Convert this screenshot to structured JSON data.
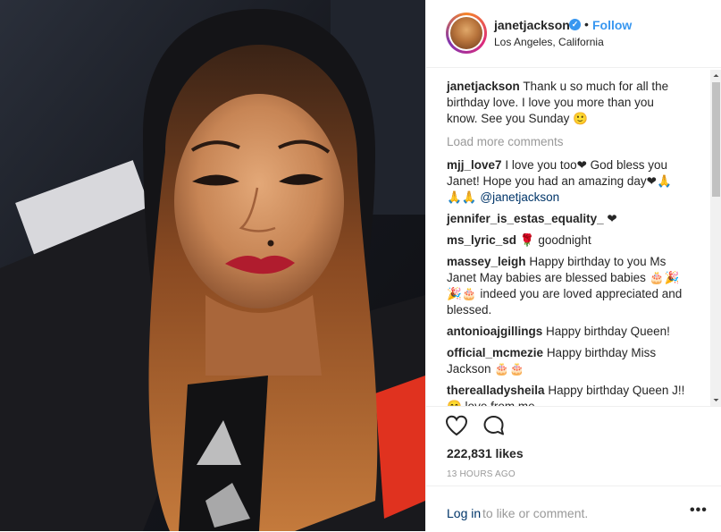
{
  "header": {
    "username": "janetjackson",
    "follow_label": "Follow",
    "dot": "•",
    "location": "Los Angeles, California"
  },
  "caption": {
    "username": "janetjackson",
    "text": "Thank u so much for all the birthday love. I love you more than you know. See you Sunday 🙂"
  },
  "load_more_label": "Load more comments",
  "comments": [
    {
      "username": "mjj_love7",
      "text": "I love you too❤ God bless you Janet! Hope you had an amazing day❤🙏 🙏🙏",
      "mention": "@janetjackson"
    },
    {
      "username": "jennifer_is_estas_equality_",
      "text": "❤"
    },
    {
      "username": "ms_lyric_sd",
      "text": "🌹 goodnight"
    },
    {
      "username": "massey_leigh",
      "text": "Happy birthday to you Ms Janet May babies are blessed babies 🎂🎉🎉🎂 indeed you are loved appreciated and blessed."
    },
    {
      "username": "antonioajgillings",
      "text": "Happy birthday Queen!"
    },
    {
      "username": "official_mcmezie",
      "text": "Happy birthday Miss Jackson 🎂🎂"
    },
    {
      "username": "therealladysheila",
      "text": "Happy birthday Queen J!! 😊 love from me"
    }
  ],
  "likes": "222,831 likes",
  "time": "13 HOURS AGO",
  "login": {
    "link": "Log in",
    "rest": "to like or comment."
  },
  "more_label": "•••",
  "icons": {
    "like": "heart-icon",
    "comment": "comment-bubble-icon",
    "verified": "verified-badge-icon"
  },
  "colors": {
    "link_blue": "#3897f0",
    "mention_blue": "#003569",
    "text": "#262626",
    "muted": "#999999"
  }
}
